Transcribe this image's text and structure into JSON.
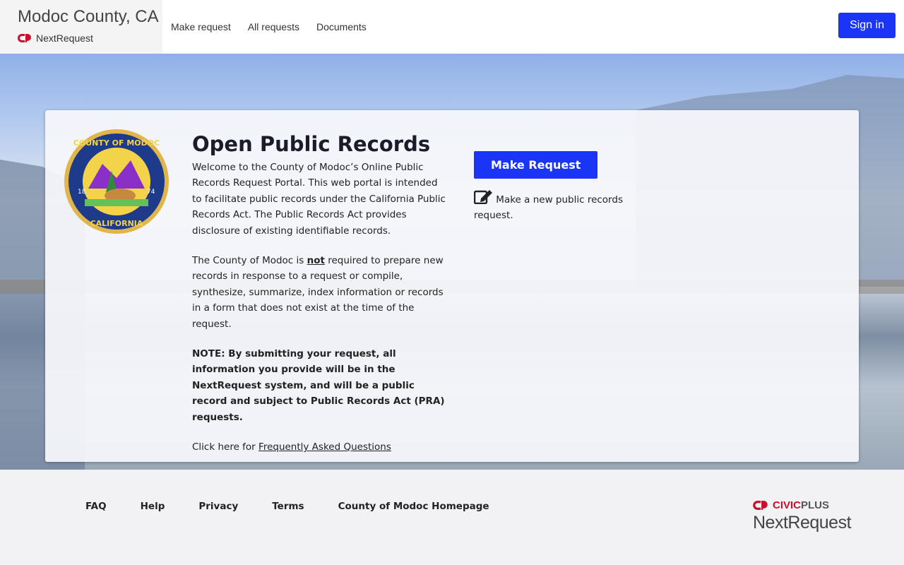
{
  "header": {
    "site_title": "Modoc County, CA",
    "product": "NextRequest",
    "nav": [
      "Make request",
      "All requests",
      "Documents"
    ],
    "sign_in": "Sign in"
  },
  "main": {
    "heading": "Open Public Records",
    "intro": "Welcome to the County of Modoc’s Online Public Records Request Portal. This web portal is intended to facilitate public records under the California Public Records Act. The Public Records Act provides disclosure of existing identifiable records.",
    "p2_before": "The County of Modoc is ",
    "p2_bold": "not",
    "p2_after": " required to prepare new records in response to a request or compile, synthesize, summarize, index information or records in a form that does not exist at the time of the request.",
    "note": "NOTE: By submitting your request, all information you provide will be in the NextRequest system, and will be a public record and subject to Public Records Act (PRA) requests.",
    "faq_prefix": "Click here for ",
    "faq_link": "Frequently Asked Questions",
    "make_request_button": "Make Request",
    "make_request_desc": "Make a new public records request.",
    "seal": {
      "top": "COUNTY OF MODOC",
      "bottom": "CALIFORNIA",
      "left_year": "18",
      "right_year": "74"
    }
  },
  "footer": {
    "links": [
      "FAQ",
      "Help",
      "Privacy",
      "Terms",
      "County of Modoc Homepage"
    ],
    "logo_civic": "CIVIC",
    "logo_plus": "PLUS",
    "logo_product": "NextRequest"
  },
  "colors": {
    "accent": "#1a35f5",
    "brand_red": "#c8102e"
  }
}
